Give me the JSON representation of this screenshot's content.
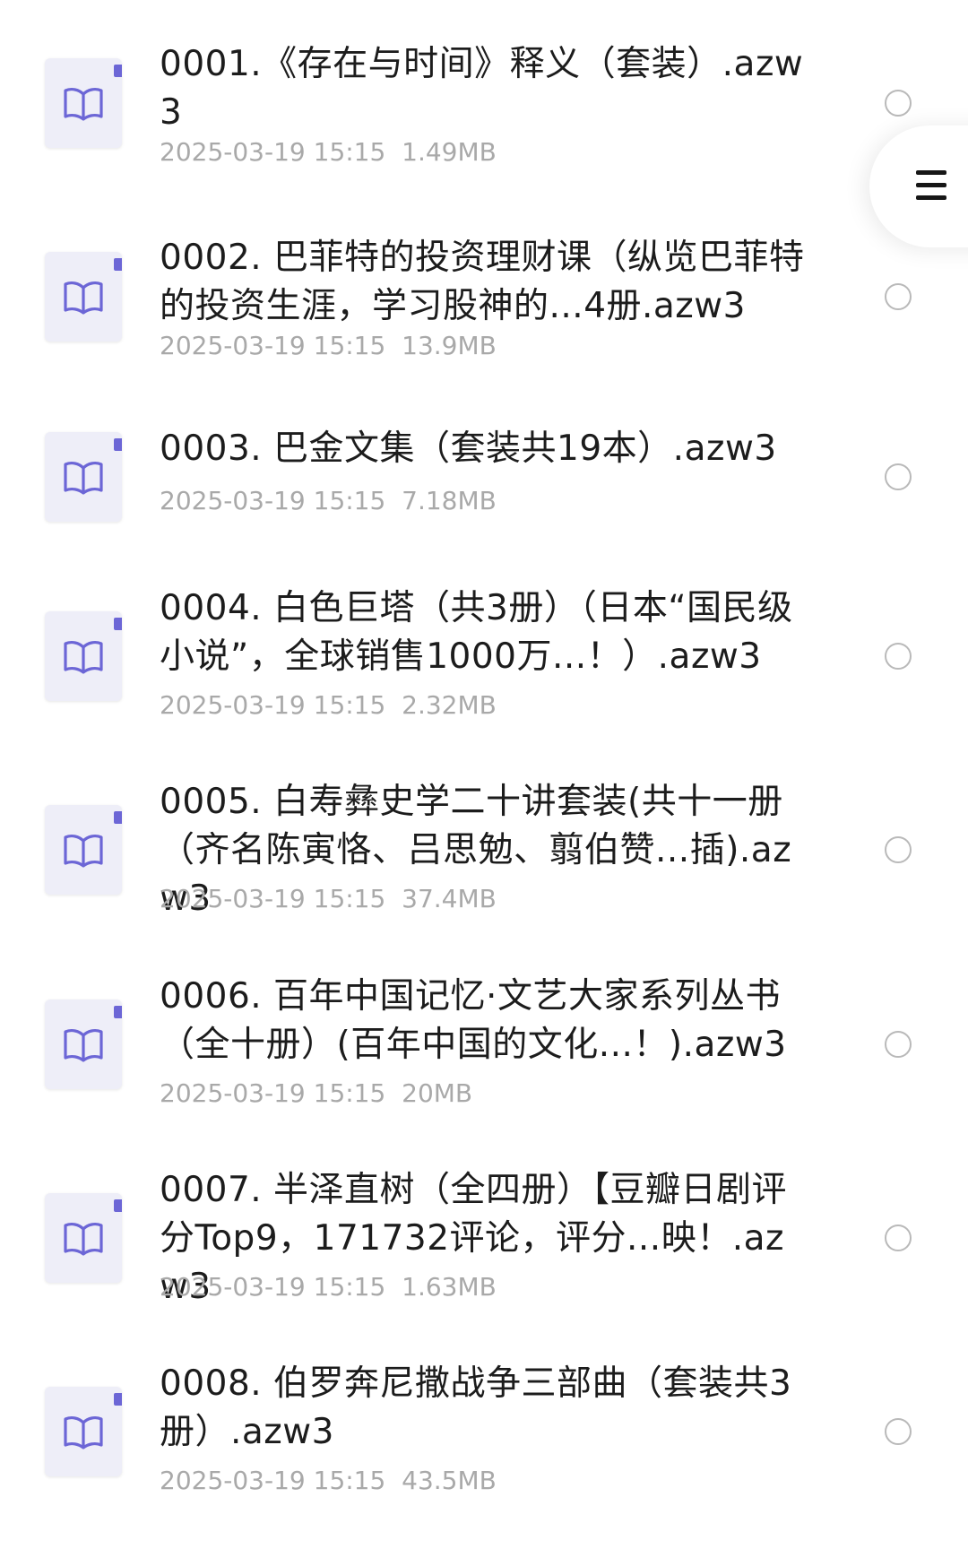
{
  "files": [
    {
      "name": "0001.《存在与时间》释义（套装）.azw3",
      "date": "2025-03-19 15:15",
      "size": "1.49MB"
    },
    {
      "name": "0002. 巴菲特的投资理财课（纵览巴菲特的投资生涯，学习股神的...4册.azw3",
      "date": "2025-03-19 15:15",
      "size": "13.9MB"
    },
    {
      "name": "0003. 巴金文集（套装共19本）.azw3",
      "date": "2025-03-19 15:15",
      "size": "7.18MB"
    },
    {
      "name": "0004. 白色巨塔（共3册）（日本“国民级小说”，全球销售1000万...！）.azw3",
      "date": "2025-03-19 15:15",
      "size": "2.32MB"
    },
    {
      "name": "0005. 白寿彝史学二十讲套装(共十一册（齐名陈寅恪、吕思勉、翦伯赞...插).azw3",
      "date": "2025-03-19 15:15",
      "size": "37.4MB"
    },
    {
      "name": "0006. 百年中国记忆·文艺大家系列丛书（全十册）(百年中国的文化...！).azw3",
      "date": "2025-03-19 15:15",
      "size": "20MB"
    },
    {
      "name": "0007. 半泽直树（全四册）【豆瓣日剧评分Top9，171732评论，评分...映！.azw3",
      "date": "2025-03-19 15:15",
      "size": "1.63MB"
    },
    {
      "name": "0008. 伯罗奔尼撒战争三部曲（套装共3册）.azw3",
      "date": "2025-03-19 15:15",
      "size": "43.5MB"
    }
  ],
  "icons": {
    "file_type": "book-icon",
    "select": "radio-circle-icon",
    "menu": "hamburger-menu-icon"
  },
  "colors": {
    "icon_tile": "#eeeef8",
    "icon_accent": "#6c66d6",
    "title_text": "#1c1c1c",
    "meta_text": "#a9a9a9",
    "radio_border": "#b9b9b9"
  }
}
